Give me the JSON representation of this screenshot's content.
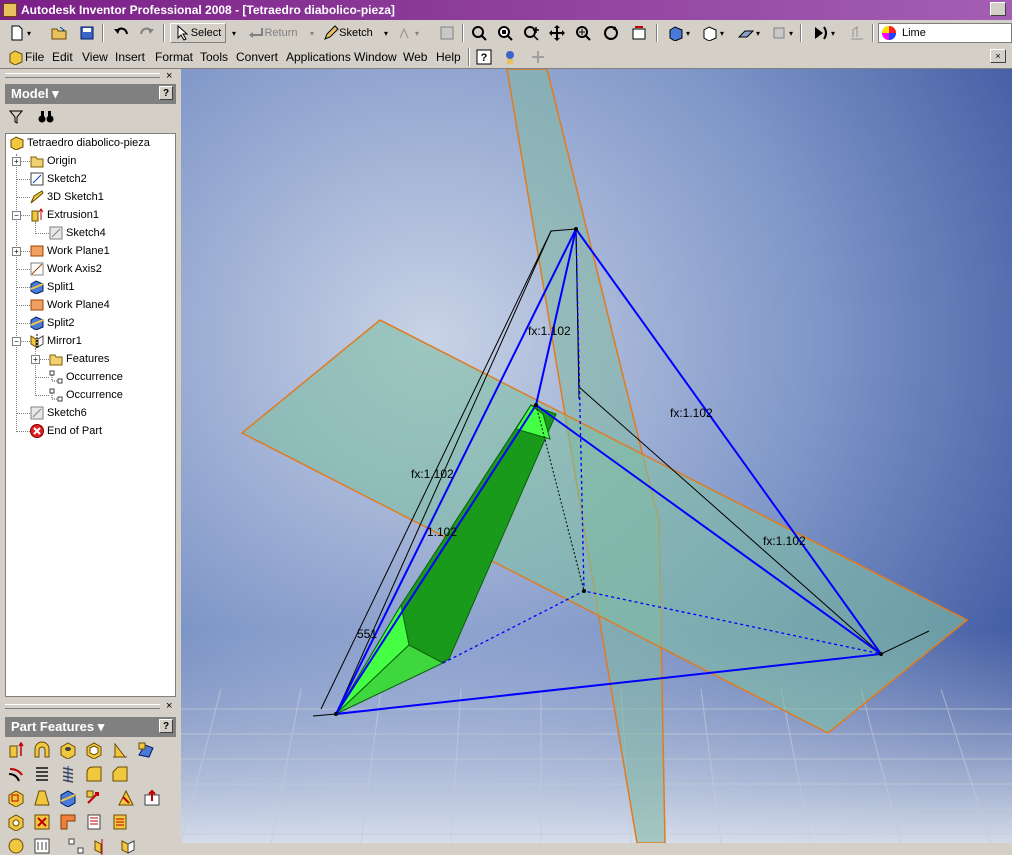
{
  "window": {
    "title": "Autodesk Inventor Professional 2008 - [Tetraedro diabolico-pieza]"
  },
  "toolbar": {
    "select_label": "Select",
    "return_label": "Return",
    "sketch_label": "Sketch",
    "color_value": "Lime"
  },
  "menu": [
    "File",
    "Edit",
    "View",
    "Insert",
    "Format",
    "Tools",
    "Convert",
    "Applications",
    "Window",
    "Web",
    "Help"
  ],
  "browser": {
    "title": "Model",
    "items": [
      {
        "label": "Tetraedro diabolico-pieza",
        "icon": "part-icon"
      },
      {
        "label": "Origin",
        "icon": "folder-icon"
      },
      {
        "label": "Sketch2",
        "icon": "sketch-icon"
      },
      {
        "label": "3D Sketch1",
        "icon": "3d-sketch-icon"
      },
      {
        "label": "Extrusion1",
        "icon": "extrusion-icon"
      },
      {
        "label": "Sketch4",
        "icon": "sketch-icon"
      },
      {
        "label": "Work Plane1",
        "icon": "work-plane-icon"
      },
      {
        "label": "Work Axis2",
        "icon": "work-axis-icon"
      },
      {
        "label": "Split1",
        "icon": "split-icon"
      },
      {
        "label": "Work Plane4",
        "icon": "work-plane-icon"
      },
      {
        "label": "Split2",
        "icon": "split-icon"
      },
      {
        "label": "Mirror1",
        "icon": "mirror-icon"
      },
      {
        "label": "Features",
        "icon": "folder-icon"
      },
      {
        "label": "Occurrence",
        "icon": "occurrence-icon"
      },
      {
        "label": "Occurrence",
        "icon": "occurrence-icon"
      },
      {
        "label": "Sketch6",
        "icon": "sketch-icon"
      },
      {
        "label": "End of Part",
        "icon": "end-of-part-icon"
      }
    ]
  },
  "part_features": {
    "title": "Part Features"
  },
  "viewport": {
    "dimensions": [
      "fx:1.102",
      "fx:1.102",
      "fx:1.102",
      "fx:1.102",
      "1.102",
      "551"
    ]
  },
  "colors": {
    "title_gradient_start": "#7a1f86",
    "viewport_bg_top": "#3a5aa0",
    "plane_fill": "#7fb8a0",
    "plane_edge": "#e07b20",
    "solid_green": "#14a014",
    "sketch_blue": "#0000ff"
  }
}
